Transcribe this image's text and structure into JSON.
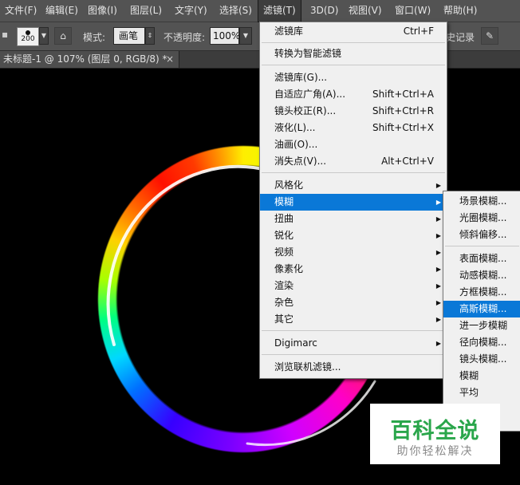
{
  "menubar": {
    "items": [
      "文件(F)",
      "编辑(E)",
      "图像(I)",
      "图层(L)",
      "文字(Y)",
      "选择(S)",
      "滤镜(T)",
      "3D(D)",
      "视图(V)",
      "窗口(W)",
      "帮助(H)"
    ],
    "active": "滤镜(T)"
  },
  "options": {
    "brush_size": "200",
    "mode_label": "模式:",
    "mode_value": "画笔",
    "opacity_label": "不透明度:",
    "opacity_value": "100%",
    "history_label": "史记录"
  },
  "document_tab": {
    "title": "未标题-1 @ 107% (图层 0, RGB/8) *",
    "close": "×"
  },
  "filter_menu": {
    "items": [
      {
        "label": "滤镜库",
        "shortcut": "Ctrl+F"
      },
      {
        "label": "转换为智能滤镜"
      },
      {
        "label": "滤镜库(G)..."
      },
      {
        "label": "自适应广角(A)...",
        "shortcut": "Shift+Ctrl+A"
      },
      {
        "label": "镜头校正(R)...",
        "shortcut": "Shift+Ctrl+R"
      },
      {
        "label": "液化(L)...",
        "shortcut": "Shift+Ctrl+X"
      },
      {
        "label": "油画(O)..."
      },
      {
        "label": "消失点(V)...",
        "shortcut": "Alt+Ctrl+V"
      },
      {
        "label": "风格化",
        "submenu": true
      },
      {
        "label": "模糊",
        "submenu": true,
        "highlighted": true
      },
      {
        "label": "扭曲",
        "submenu": true
      },
      {
        "label": "锐化",
        "submenu": true
      },
      {
        "label": "视频",
        "submenu": true
      },
      {
        "label": "像素化",
        "submenu": true
      },
      {
        "label": "渲染",
        "submenu": true
      },
      {
        "label": "杂色",
        "submenu": true
      },
      {
        "label": "其它",
        "submenu": true
      },
      {
        "label": "Digimarc",
        "submenu": true
      },
      {
        "label": "浏览联机滤镜..."
      }
    ]
  },
  "blur_submenu": {
    "items": [
      {
        "label": "场景模糊..."
      },
      {
        "label": "光圈模糊..."
      },
      {
        "label": "倾斜偏移..."
      },
      {
        "label": "表面模糊..."
      },
      {
        "label": "动感模糊..."
      },
      {
        "label": "方框模糊..."
      },
      {
        "label": "高斯模糊...",
        "highlighted": true
      },
      {
        "label": "进一步模糊"
      },
      {
        "label": "径向模糊..."
      },
      {
        "label": "镜头模糊..."
      },
      {
        "label": "模糊"
      },
      {
        "label": "平均"
      }
    ]
  },
  "watermark": {
    "title": "百科全说",
    "subtitle": "助你轻松解决"
  },
  "icons": {
    "submenu_arrow": "▶",
    "dropdown_arrow": "▼"
  },
  "colors": {
    "highlight": "#0a78d7",
    "menu_bg": "#f0f0f0",
    "ui_bg": "#535353",
    "watermark_green": "#2aa64b"
  }
}
